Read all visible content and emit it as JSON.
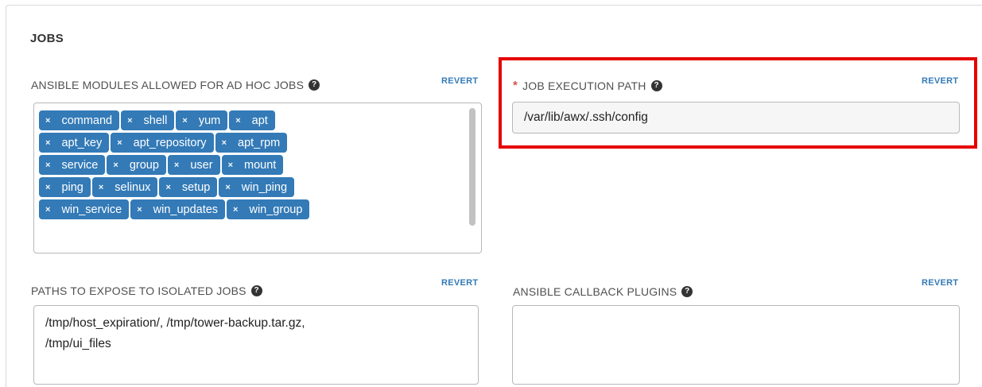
{
  "section": {
    "title": "JOBS"
  },
  "common": {
    "revert_label": "REVERT",
    "help_glyph": "?"
  },
  "ansible_modules": {
    "label": "ANSIBLE MODULES ALLOWED FOR AD HOC JOBS",
    "remove_glyph": "×",
    "tags": [
      "command",
      "shell",
      "yum",
      "apt",
      "apt_key",
      "apt_repository",
      "apt_rpm",
      "service",
      "group",
      "user",
      "mount",
      "ping",
      "selinux",
      "setup",
      "win_ping",
      "win_service",
      "win_updates",
      "win_group"
    ]
  },
  "job_execution_path": {
    "required_marker": "*",
    "label": "JOB EXECUTION PATH",
    "value": "/var/lib/awx/.ssh/config"
  },
  "isolated_paths": {
    "label": "PATHS TO EXPOSE TO ISOLATED JOBS",
    "value_line1": "/tmp/host_expiration/, /tmp/tower-backup.tar.gz,",
    "value_line2": "/tmp/ui_files"
  },
  "callback_plugins": {
    "label": "ANSIBLE CALLBACK PLUGINS",
    "value": ""
  },
  "colors": {
    "tag_bg": "#337ab7",
    "link": "#337ab7",
    "highlight": "#e60000",
    "required": "#d9534f"
  },
  "icons": {
    "help": "question-circle-icon",
    "tag_remove": "close-icon"
  }
}
